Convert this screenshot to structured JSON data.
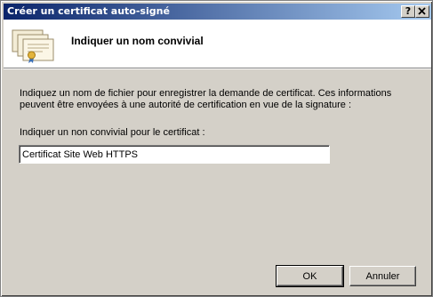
{
  "window": {
    "title": "Créer un certificat auto-signé",
    "help_button": "?",
    "close_button": "X"
  },
  "header": {
    "title": "Indiquer un nom convivial",
    "icon": "certificate-icon"
  },
  "body": {
    "description": "Indiquez un nom de fichier pour enregistrer la demande de certificat. Ces informations peuvent être envoyées à une autorité de certification en vue de la signature :",
    "field_label": "Indiquer un non convivial pour le certificat :",
    "field_value": "Certificat Site Web HTTPS"
  },
  "buttons": {
    "ok_label": "OK",
    "cancel_label": "Annuler"
  },
  "colors": {
    "title_gradient_start": "#0a246a",
    "title_gradient_end": "#a6caf0",
    "dialog_background": "#d4d0c8",
    "header_background": "#ffffff"
  }
}
